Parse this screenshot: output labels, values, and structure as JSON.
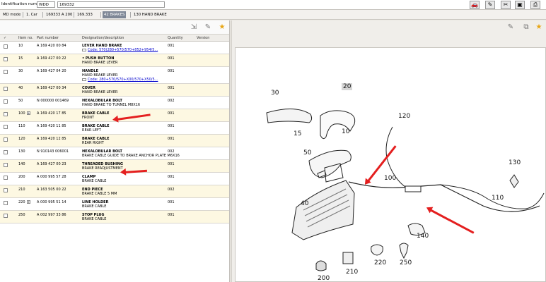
{
  "header": {
    "id_label": "Identification number",
    "id_prefix": "WDD",
    "id_value": "169332",
    "icons": [
      "car-icon",
      "edit-icon",
      "tools-icon",
      "save-icon",
      "print-icon"
    ]
  },
  "breadcrumb": [
    {
      "text": "MD mode",
      "active": false
    },
    {
      "text": "1. Car",
      "active": false
    },
    {
      "text": "169333 A 200",
      "active": false
    },
    {
      "text": "169.333",
      "active": false
    },
    {
      "text": "42 BRAKES",
      "active": true
    },
    {
      "text": "130 HAND BRAKE",
      "active": false
    }
  ],
  "table": {
    "columns": [
      "✓",
      "Item no.",
      "Part number",
      "Designation/description",
      "Quantity",
      "Version"
    ],
    "rows": [
      {
        "item": "10",
        "part": "A 169 420 00 84",
        "name": "LEVER HAND BRAKE",
        "desc": "",
        "code": "Code: 570(280+570/570+852+954/5...",
        "qty": "001",
        "alt": false,
        "plus": false
      },
      {
        "item": "15",
        "part": "A 169 427 00 22",
        "name": "• PUSH BUTTON",
        "desc": "HAND BRAKE LEVER",
        "code": "",
        "qty": "001",
        "alt": true,
        "plus": false
      },
      {
        "item": "30",
        "part": "A 169 427 04 20",
        "name": "HANDLE",
        "desc": "HAND BRAKE LEVER",
        "code": "Code: 280+570/570+X00/570+X50/5...",
        "qty": "001",
        "alt": false,
        "plus": false
      },
      {
        "item": "40",
        "part": "A 169 427 00 34",
        "name": "COVER",
        "desc": "HAND BRAKE LEVER",
        "code": "",
        "qty": "001",
        "alt": true,
        "plus": false
      },
      {
        "item": "50",
        "part": "N 000000 001469",
        "name": "HEXALOBULAR BOLT",
        "desc": "HAND BRAKE TO TUNNEL M8X16",
        "code": "",
        "qty": "002",
        "alt": false,
        "plus": false
      },
      {
        "item": "100",
        "part": "A 169 420 17 85",
        "name": "BRAKE CABLE",
        "desc": "FRONT",
        "code": "",
        "qty": "001",
        "alt": true,
        "plus": true
      },
      {
        "item": "110",
        "part": "A 169 420 11 85",
        "name": "BRAKE CABLE",
        "desc": "REAR LEFT",
        "code": "",
        "qty": "001",
        "alt": false,
        "plus": false
      },
      {
        "item": "120",
        "part": "A 169 420 12 85",
        "name": "BRAKE CABLE",
        "desc": "REAR RIGHT",
        "code": "",
        "qty": "001",
        "alt": true,
        "plus": false
      },
      {
        "item": "130",
        "part": "N 910143 006001",
        "name": "HEXALOBULAR BOLT",
        "desc": "BRAKE CABLE GUIDE TO BRAKE ANCHOR PLATE M6X16",
        "code": "",
        "qty": "002",
        "alt": false,
        "plus": false
      },
      {
        "item": "140",
        "part": "A 169 427 00 23",
        "name": "THREADED BUSHING",
        "desc": "BRAKE READJUSTMENT",
        "code": "",
        "qty": "001",
        "alt": true,
        "plus": false
      },
      {
        "item": "200",
        "part": "A 000 995 57 28",
        "name": "CLAMP",
        "desc": "BRAKE CABLE",
        "code": "",
        "qty": "001",
        "alt": false,
        "plus": false
      },
      {
        "item": "210",
        "part": "A 163 505 00 22",
        "name": "END PIECE",
        "desc": "BRAKE CABLE 5 MM",
        "code": "",
        "qty": "002",
        "alt": true,
        "plus": false
      },
      {
        "item": "220",
        "part": "A 000 995 51 14",
        "name": "LINE HOLDER",
        "desc": "BRAKE CABLE",
        "code": "",
        "qty": "001",
        "alt": false,
        "plus": true
      },
      {
        "item": "250",
        "part": "A 002 997 33 86",
        "name": "STOP PLUG",
        "desc": "BRAKE CABLE",
        "code": "",
        "qty": "001",
        "alt": true,
        "plus": false
      }
    ]
  },
  "diagram": {
    "callouts": [
      "30",
      "20",
      "120",
      "15",
      "10",
      "50",
      "130",
      "100",
      "40",
      "110",
      "140",
      "200",
      "210",
      "220",
      "250"
    ]
  }
}
